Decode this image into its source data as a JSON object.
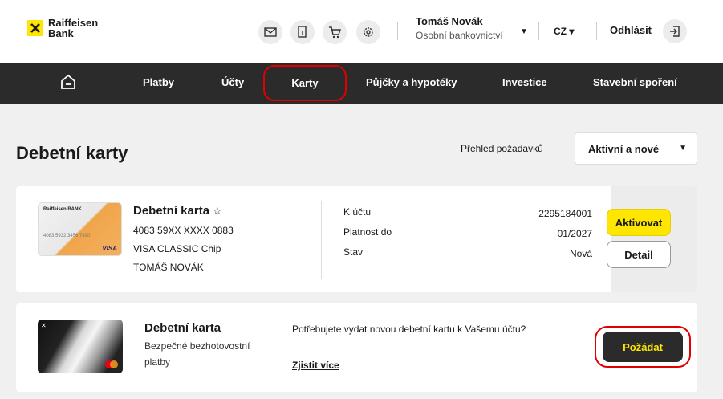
{
  "header": {
    "logo_line1": "Raiffeisen",
    "logo_line2": "Bank",
    "user_name": "Tomáš Novák",
    "user_segment": "Osobní bankovnictví",
    "language": "CZ",
    "logout_label": "Odhlásit"
  },
  "nav": {
    "items": [
      "Platby",
      "Účty",
      "Karty",
      "Půjčky a hypotéky",
      "Investice",
      "Stavební spoření"
    ]
  },
  "page": {
    "title": "Debetní karty",
    "requests_link": "Přehled požadavků",
    "filter_value": "Aktivní a nové"
  },
  "card1": {
    "title": "Debetní karta",
    "star": "☆",
    "number": "4083 59XX XXXX 0883",
    "type": "VISA CLASSIC Chip",
    "holder": "TOMÁŠ NOVÁK",
    "img_brand": "Raiffeisen BANK",
    "img_number": "4083 5932 3456 7890",
    "img_network": "VISA",
    "account_label": "K účtu",
    "account_value": "2295184001",
    "validity_label": "Platnost do",
    "validity_value": "01/2027",
    "status_label": "Stav",
    "status_value": "Nová",
    "activate_label": "Aktivovat",
    "detail_label": "Detail"
  },
  "promo": {
    "title": "Debetní karta",
    "subtitle": "Bezpečné bezhotovostní platby",
    "text": "Potřebujete vydat novou debetní kartu k Vašemu účtu?",
    "link": "Zjistit více",
    "button": "Požádat"
  },
  "colors": {
    "brand_yellow": "#fee600",
    "nav_bg": "#2b2b2b",
    "highlight_red": "#e00000"
  }
}
